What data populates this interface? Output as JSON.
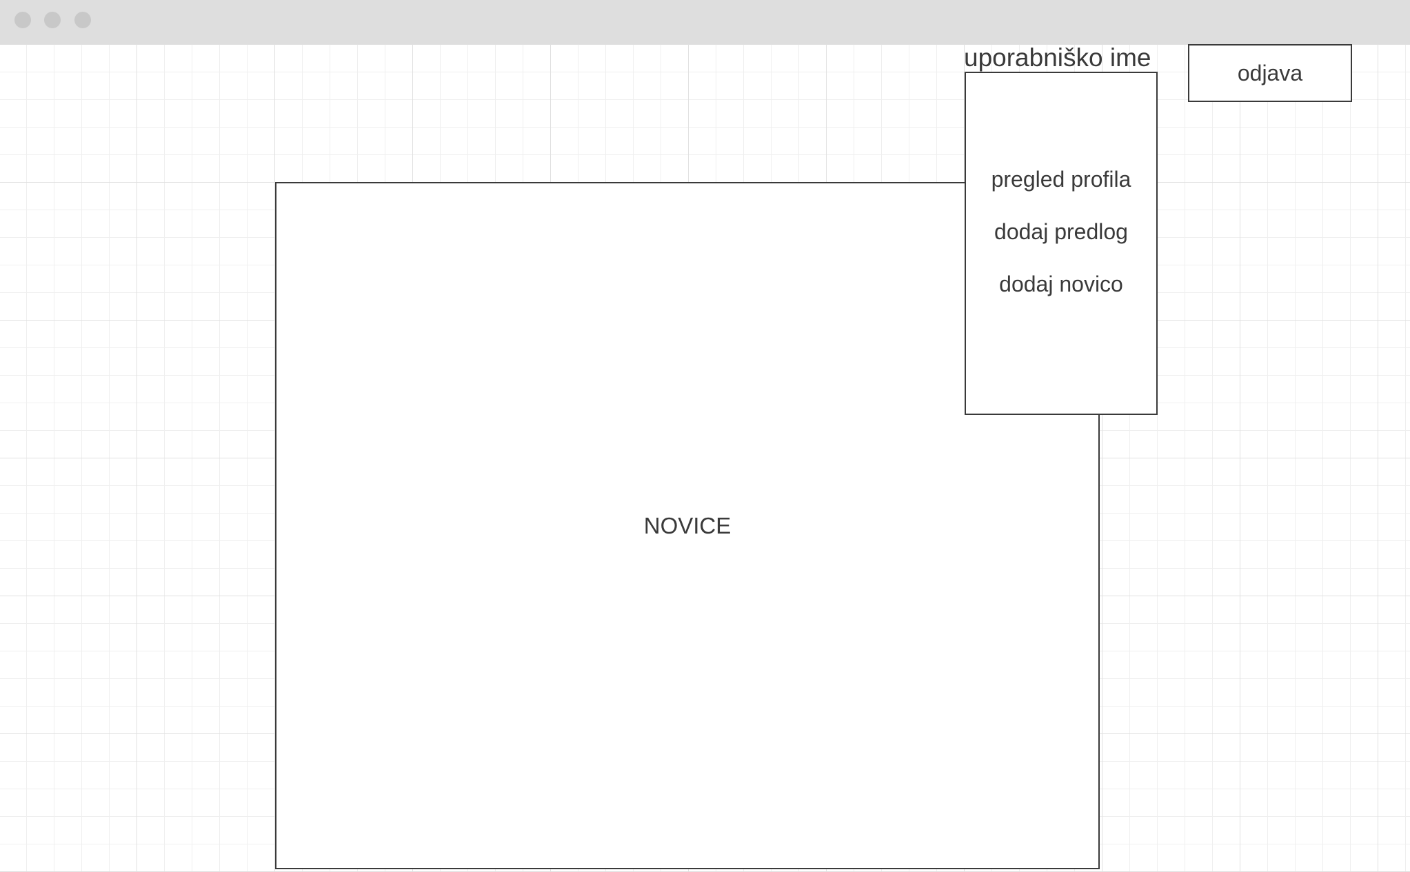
{
  "header": {
    "username": "uporabniško ime",
    "logout_label": "odjava"
  },
  "user_menu": {
    "items": [
      {
        "label": "pregled profila"
      },
      {
        "label": "dodaj predlog"
      },
      {
        "label": "dodaj novico"
      }
    ]
  },
  "main": {
    "news_title": "NOVICE"
  },
  "colors": {
    "titlebar": "#dedede",
    "window_dots": "#c8c8c8",
    "border": "#3a3a3a",
    "text": "#3a3a3a",
    "grid_major": "#e0e0e0",
    "grid_minor": "#efefef"
  }
}
